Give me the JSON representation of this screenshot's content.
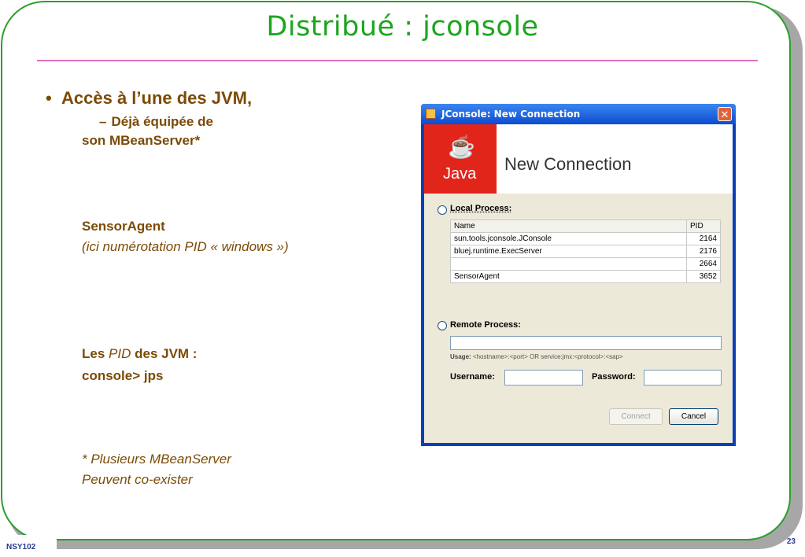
{
  "slide": {
    "title": "Distribué : jconsole",
    "footer_left": "NSY102",
    "page_number": "23"
  },
  "content": {
    "bullet": "Accès à l’une des JVM,",
    "sub_dash": "–",
    "sub_line1": "Déjà équipée de",
    "sub_line2": "son MBeanServer*",
    "sensor_agent": "SensorAgent",
    "sensor_note": "(ici numérotation PID « windows »)",
    "pid_prefix": "Les",
    "pid_italic": "PID",
    "pid_suffix": "des JVM :",
    "jps_cmd": "console> jps",
    "footnote1": "* Plusieurs MBeanServer",
    "footnote2": "Peuvent co-exister"
  },
  "dialog": {
    "window_title": "JConsole: New Connection",
    "close_glyph": "✕",
    "java_logo_text": "Java",
    "header_title": "New Connection",
    "local_process_label": "Local Process:",
    "columns": [
      "Name",
      "PID"
    ],
    "processes": [
      {
        "name": "sun.tools.jconsole.JConsole",
        "pid": "2164"
      },
      {
        "name": "bluej.runtime.ExecServer",
        "pid": "2176"
      },
      {
        "name": "",
        "pid": "2664"
      },
      {
        "name": "SensorAgent",
        "pid": "3652"
      }
    ],
    "remote_process_label": "Remote Process:",
    "usage_label": "Usage:",
    "usage_text": "<hostname>:<port> OR service:jmx:<protocol>:<sap>",
    "username_label": "Username:",
    "password_label": "Password:",
    "connect_label": "Connect",
    "cancel_label": "Cancel"
  },
  "colors": {
    "title_green": "#1ea51e",
    "rule_pink": "#e06fc0",
    "text_brown": "#7b4b06",
    "java_red": "#e1251b",
    "xp_blue": "#0b4cd0"
  }
}
